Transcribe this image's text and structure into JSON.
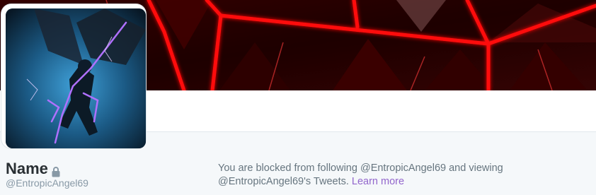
{
  "profile": {
    "name": "Name",
    "handle": "@EntropicAngel69",
    "protected_icon": "lock-icon"
  },
  "blocked_notice": {
    "message": "You are blocked from following @EntropicAngel69 and viewing @EntropicAngel69's Tweets.",
    "learn_more_label": "Learn more"
  },
  "colors": {
    "banner_red": "#ff0000",
    "banner_dark": "#1a0000",
    "page_bg": "#f5f8fa",
    "link": "#9266cc",
    "name_text": "#292f33",
    "muted_text": "#66757f"
  }
}
